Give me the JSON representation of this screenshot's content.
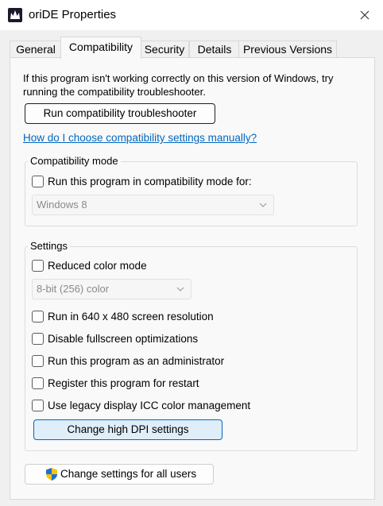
{
  "window": {
    "title": "oriDE Properties"
  },
  "tabs": [
    {
      "label": "General"
    },
    {
      "label": "Compatibility"
    },
    {
      "label": "Security"
    },
    {
      "label": "Details"
    },
    {
      "label": "Previous Versions"
    }
  ],
  "active_tab": "Compatibility",
  "intro_text": "If this program isn't working correctly on this version of Windows, try running the compatibility troubleshooter.",
  "troubleshooter_button": "Run compatibility troubleshooter",
  "help_link": "How do I choose compatibility settings manually?",
  "compat_mode": {
    "group_label": "Compatibility mode",
    "checkbox_label": "Run this program in compatibility mode for:",
    "checked": false,
    "os_value": "Windows 8"
  },
  "settings": {
    "group_label": "Settings",
    "reduced_color": {
      "label": "Reduced color mode",
      "checked": false
    },
    "color_value": "8-bit (256) color",
    "res_640": {
      "label": "Run in 640 x 480 screen resolution",
      "checked": false
    },
    "fullscreen": {
      "label": "Disable fullscreen optimizations",
      "checked": false
    },
    "admin": {
      "label": "Run this program as an administrator",
      "checked": false
    },
    "restart": {
      "label": "Register this program for restart",
      "checked": false
    },
    "icc": {
      "label": "Use legacy display ICC color management",
      "checked": false
    },
    "dpi_button": "Change high DPI settings"
  },
  "all_users_button": "Change settings for all users",
  "colors": {
    "link": "#0067c0",
    "panel": "#f9f9f9",
    "hover_button": "#e0eef9",
    "shield_blue": "#1f6fd1",
    "shield_yellow": "#f5c518"
  },
  "icons": {
    "app": "crown-logo-icon",
    "close": "close-icon",
    "shield": "uac-shield-icon",
    "dropdown": "chevron-down-icon"
  }
}
